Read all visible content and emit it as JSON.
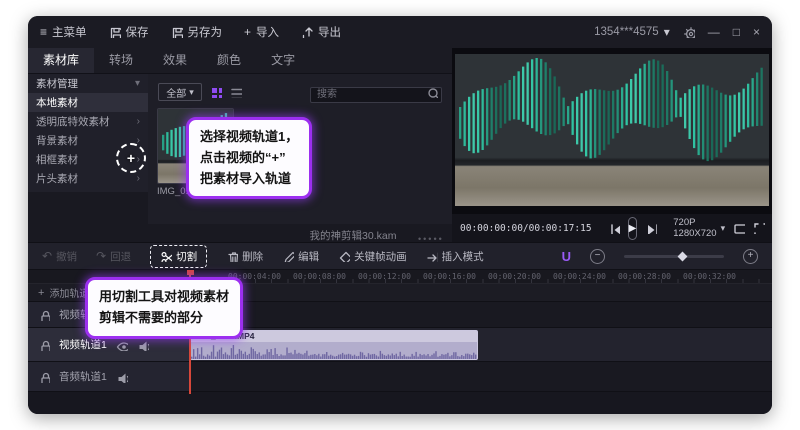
{
  "topbar": {
    "main_menu": "主菜单",
    "save": "保存",
    "save_as": "另存为",
    "import": "导入",
    "export": "导出",
    "account": "1354***4575"
  },
  "tabs": [
    {
      "label": "素材库"
    },
    {
      "label": "转场"
    },
    {
      "label": "效果"
    },
    {
      "label": "颜色"
    },
    {
      "label": "文字"
    }
  ],
  "sidebar": {
    "items": [
      {
        "label": "素材管理"
      },
      {
        "label": "本地素材"
      },
      {
        "label": "透明底特效素材"
      },
      {
        "label": "背景素材"
      },
      {
        "label": "相框素材"
      },
      {
        "label": "片头素材"
      }
    ]
  },
  "library": {
    "filter": "全部",
    "search_placeholder": "搜索",
    "thumbnail_name": "IMG_0153.MP4",
    "add_button": "+",
    "project_name": "我的神剪辑30.kam"
  },
  "preview": {
    "timecode": "00:00:00:00/00:00:17:15",
    "resolution": "720P 1280X720"
  },
  "toolbar": {
    "undo": "撤销",
    "back": "回退",
    "cut": "切割",
    "delete": "删除",
    "edit": "编辑",
    "keyframe": "关键帧动画",
    "insert": "插入模式",
    "magnet": "U"
  },
  "timeline": {
    "add_track": "添加轨道",
    "ruler": [
      "00:00:04:00",
      "00:00:08:00",
      "00:00:12:00",
      "00:00:16:00",
      "00:00:20:00",
      "00:00:24:00",
      "00:00:28:00",
      "00:00:32:00"
    ],
    "tracks": [
      {
        "label": "视频轨道2"
      },
      {
        "label": "视频轨道1"
      },
      {
        "label": "音频轨道1"
      }
    ],
    "clip_name": "IMG_0153.MP4"
  },
  "callouts": {
    "import_tip_lines": [
      "选择视频轨道1，",
      "点击视频的“+”",
      "把素材导入轨道"
    ],
    "cut_tip_lines": [
      "用切割工具对视频素材",
      "剪辑不需要的部分"
    ]
  },
  "colors": {
    "accent": "#8f4bf2",
    "callout_border": "#9c2ff0",
    "playhead": "#d6473a",
    "clip": "#b2adcc",
    "stripe": "#2fc39e"
  }
}
